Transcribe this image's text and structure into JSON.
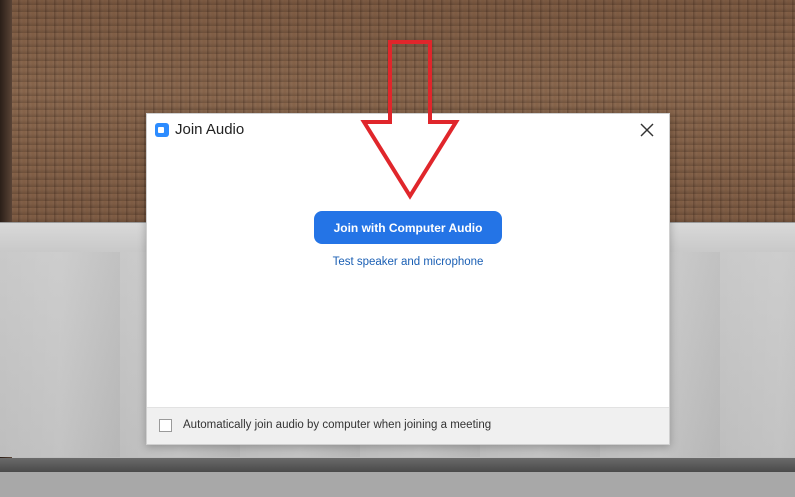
{
  "dialog": {
    "title": "Join Audio",
    "primary_button_label": "Join with Computer Audio",
    "test_link_label": "Test speaker and microphone",
    "auto_join_checkbox_label": "Automatically join audio by computer when joining a meeting",
    "auto_join_checked": false
  },
  "icons": {
    "app": "zoom-app-icon",
    "close": "close-icon",
    "annotation": "red-arrow-down-icon"
  },
  "colors": {
    "primary_button": "#2474e6",
    "link": "#1a5fb4",
    "app_icon": "#2d8cff",
    "arrow": "#e0262b"
  }
}
